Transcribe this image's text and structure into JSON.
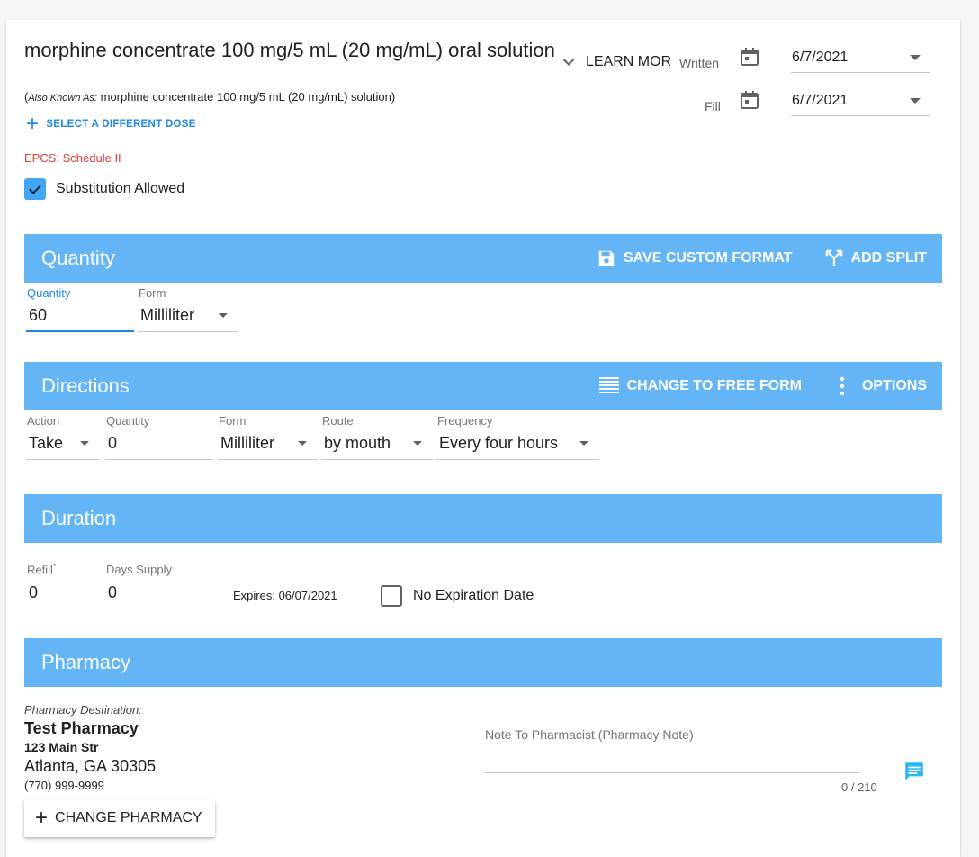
{
  "colors": {
    "band": "#64b5f6",
    "accent": "#1e88e5",
    "error": "#e53935"
  },
  "drug": {
    "title": "morphine concentrate 100 mg/5 mL (20 mg/mL) oral solution",
    "aka_prefix": "Also Known As:",
    "aka_value": "morphine concentrate 100 mg/5 mL (20 mg/mL) solution",
    "aka_open": "(",
    "aka_close": ")",
    "select_dose": "SELECT A DIFFERENT DOSE",
    "epcs": "EPCS: Schedule II",
    "substitution_label": "Substitution Allowed",
    "substitution_checked": true,
    "learn_more": "LEARN MORE"
  },
  "dates": {
    "written_label": "Written",
    "written_value": "6/7/2021",
    "fill_label": "Fill",
    "fill_value": "6/7/2021"
  },
  "quantity": {
    "title": "Quantity",
    "save_custom": "SAVE CUSTOM FORMAT",
    "add_split": "ADD SPLIT",
    "qty_label": "Quantity",
    "qty_value": "60",
    "form_label": "Form",
    "form_value": "Milliliter"
  },
  "directions": {
    "title": "Directions",
    "free_form": "CHANGE TO FREE FORM",
    "options": "OPTIONS",
    "action_label": "Action",
    "action_value": "Take",
    "qty_label": "Quantity",
    "qty_value": "0",
    "form_label": "Form",
    "form_value": "Milliliter",
    "route_label": "Route",
    "route_value": "by mouth",
    "freq_label": "Frequency",
    "freq_value": "Every four hours"
  },
  "duration": {
    "title": "Duration",
    "refill_label": "Refill",
    "refill_required": "*",
    "refill_value": "0",
    "days_label": "Days Supply",
    "days_value": "0",
    "expires": "Expires: 06/07/2021",
    "no_expiration": "No Expiration Date",
    "no_expiration_checked": false
  },
  "pharmacy": {
    "title": "Pharmacy",
    "dest_label": "Pharmacy Destination:",
    "name": "Test Pharmacy",
    "address1": "123 Main Str",
    "address2": "Atlanta, GA 30305",
    "phone": "(770) 999-9999",
    "change_button": "CHANGE PHARMACY",
    "note_label": "Note To Pharmacist (Pharmacy Note)",
    "note_count": "0 / 210"
  }
}
